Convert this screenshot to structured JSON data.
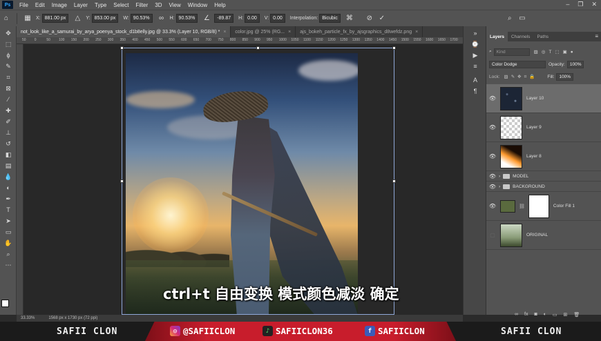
{
  "menubar": {
    "app_logo": "Ps",
    "items": [
      "File",
      "Edit",
      "Image",
      "Layer",
      "Type",
      "Select",
      "Filter",
      "3D",
      "View",
      "Window",
      "Help"
    ]
  },
  "options": {
    "x_label": "X:",
    "x_value": "881.00 px",
    "y_label": "Y:",
    "y_value": "853.00 px",
    "w_label": "W:",
    "w_value": "90.53%",
    "h_label": "H:",
    "h_value": "90.53%",
    "angle_value": "-89.87",
    "hskew_label": "H:",
    "hskew_value": "0.00",
    "vskew_label": "V:",
    "vskew_value": "0.00",
    "interp_label": "Interpolation:",
    "interp_value": "Bicubic"
  },
  "tabs": [
    {
      "label": "not_look_like_a_samurai_by_arya_poenya_stock_d1b8elly.jpg @ 33.3% (Layer 10, RGB/8) *",
      "active": true
    },
    {
      "label": "color.jpg @ 25% (RG...",
      "active": false
    },
    {
      "label": "ajs_bokeh_particle_fx_by_ajsgraphics_d8wefdz.png",
      "active": false
    }
  ],
  "ruler_ticks": [
    "50",
    "0",
    "50",
    "100",
    "150",
    "200",
    "250",
    "300",
    "350",
    "400",
    "450",
    "500",
    "550",
    "600",
    "650",
    "700",
    "750",
    "800",
    "850",
    "900",
    "950",
    "1000",
    "1050",
    "1100",
    "1150",
    "1200",
    "1250",
    "1300",
    "1350",
    "1400",
    "1450",
    "1500",
    "1550",
    "1600",
    "1650",
    "1700"
  ],
  "subtitle": "ctrl+t 自由变换 模式颜色减淡 确定",
  "status": {
    "zoom": "33.33%",
    "doc_size": "1568 px x 1730 px (72 ppi)"
  },
  "layers_panel": {
    "tabs": [
      "Layers",
      "Channels",
      "Paths"
    ],
    "filter_placeholder": "Kind",
    "blend_mode": "Color Dodge",
    "opacity_label": "Opacity:",
    "opacity_value": "100%",
    "lock_label": "Lock:",
    "fill_label": "Fill:",
    "fill_value": "100%",
    "layers": [
      {
        "name": "Layer 10",
        "selected": true
      },
      {
        "name": "Layer 9",
        "selected": false
      },
      {
        "name": "Layer 8",
        "selected": false
      },
      {
        "name": "MODEL",
        "group": true
      },
      {
        "name": "BACKGROUND",
        "group": true
      },
      {
        "name": "Color Fill 1",
        "selected": false
      },
      {
        "name": "ORIGINAL",
        "selected": false
      }
    ]
  },
  "banner": {
    "left_name": "SAFII CLON",
    "instagram": "@SAFIICLON",
    "tiktok": "SAFIICLON36",
    "facebook": "SAFIICLON",
    "right_name": "SAFII CLON"
  },
  "colors": {
    "accent": "#c81d2c",
    "selection": "#8fa8d8",
    "panel": "#535353"
  }
}
